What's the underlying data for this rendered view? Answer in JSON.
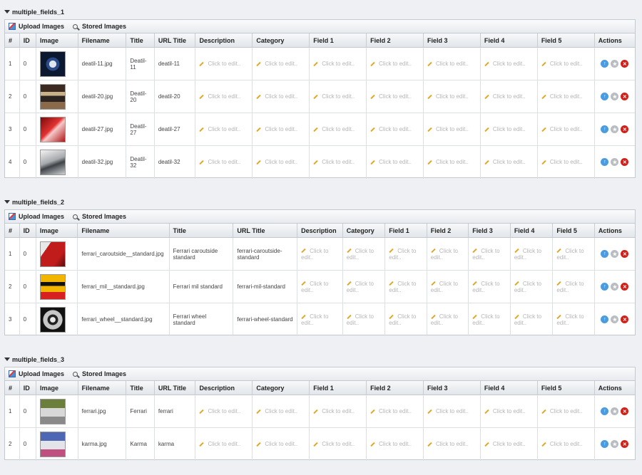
{
  "sections": [
    {
      "title": "multiple_fields_1",
      "toolbar": {
        "upload_label": "Upload Images",
        "stored_label": "Stored Images"
      },
      "columns": [
        "#",
        "ID",
        "Image",
        "Filename",
        "Title",
        "URL Title",
        "Description",
        "Category",
        "Field 1",
        "Field 2",
        "Field 3",
        "Field 4",
        "Field 5",
        "Actions"
      ],
      "rows": [
        {
          "num": "1",
          "id": "0",
          "image": "clock-thumbnail",
          "filename": "deatil-11.jpg",
          "title": "Deatil-11",
          "url_title": "deatil-11"
        },
        {
          "num": "2",
          "id": "0",
          "image": "dashboard-thumbnail",
          "filename": "deatil-20.jpg",
          "title": "Deatil-20",
          "url_title": "deatil-20"
        },
        {
          "num": "3",
          "id": "0",
          "image": "red-car-detail-thumbnail",
          "filename": "deatil-27.jpg",
          "title": "Deatil-27",
          "url_title": "deatil-27"
        },
        {
          "num": "4",
          "id": "0",
          "image": "silver-car-thumbnail",
          "filename": "deatil-32.jpg",
          "title": "Deatil-32",
          "url_title": "deatil-32"
        }
      ]
    },
    {
      "title": "multiple_fields_2",
      "toolbar": {
        "upload_label": "Upload Images",
        "stored_label": "Stored Images"
      },
      "columns": [
        "#",
        "ID",
        "Image",
        "Filename",
        "Title",
        "URL Title",
        "Description",
        "Category",
        "Field 1",
        "Field 2",
        "Field 3",
        "Field 4",
        "Field 5",
        "Actions"
      ],
      "rows": [
        {
          "num": "1",
          "id": "0",
          "image": "red-car-outside-thumbnail",
          "filename": "ferrari_caroutside__standard.jpg",
          "title": "Ferrari caroutside standard",
          "url_title": "ferrari-caroutside-standard"
        },
        {
          "num": "2",
          "id": "0",
          "image": "yellow-badge-thumbnail",
          "filename": "ferrari_mil__standard.jpg",
          "title": "Ferrari mil standard",
          "url_title": "ferrari-mil-standard"
        },
        {
          "num": "3",
          "id": "0",
          "image": "wheel-thumbnail",
          "filename": "ferrari_wheel__standard.jpg",
          "title": "Ferrari wheel standard",
          "url_title": "ferrari-wheel-standard"
        }
      ]
    },
    {
      "title": "multiple_fields_3",
      "toolbar": {
        "upload_label": "Upload Images",
        "stored_label": "Stored Images"
      },
      "columns": [
        "#",
        "ID",
        "Image",
        "Filename",
        "Title",
        "URL Title",
        "Description",
        "Category",
        "Field 1",
        "Field 2",
        "Field 3",
        "Field 4",
        "Field 5",
        "Actions"
      ],
      "rows": [
        {
          "num": "1",
          "id": "0",
          "image": "ferrari-street-thumbnail",
          "filename": "ferrari.jpg",
          "title": "Ferrari",
          "url_title": "ferrari"
        },
        {
          "num": "2",
          "id": "0",
          "image": "karma-car-thumbnail",
          "filename": "karma.jpg",
          "title": "Karma",
          "url_title": "karma"
        }
      ]
    }
  ],
  "edit_placeholder": "Click to edit..",
  "actions": [
    "info-icon",
    "star-icon",
    "delete-icon"
  ],
  "colors": {
    "info": "#4a9be0",
    "star": "#b9bdc2",
    "delete": "#d0211a",
    "edit_text": "#b5b5b5",
    "pencil": "#e0a628"
  }
}
